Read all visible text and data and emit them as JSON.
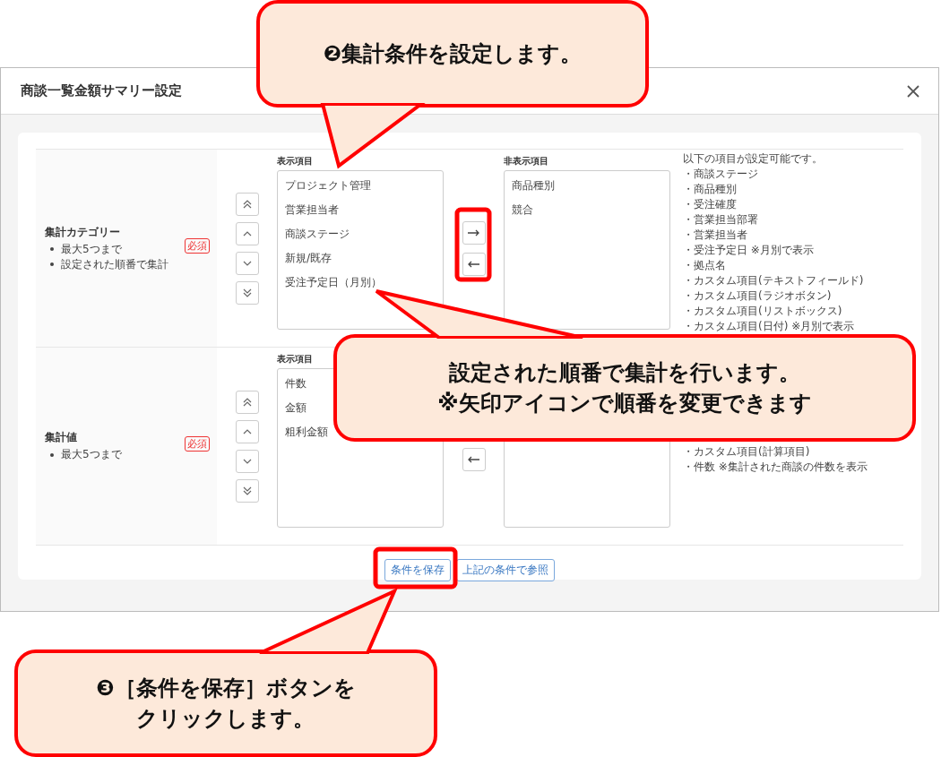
{
  "dialog": {
    "title": "商談一覧金額サマリー設定"
  },
  "sections": [
    {
      "label": "集計カテゴリー",
      "bullets": [
        "最大5つまで",
        "設定された順番で集計"
      ],
      "badge": "必須",
      "order_buttons": [
        {
          "kind": "top"
        },
        {
          "kind": "up"
        },
        {
          "kind": "down"
        },
        {
          "kind": "bottom"
        }
      ],
      "shown_header": "表示項目",
      "shown_items": [
        "プロジェクト管理",
        "営業担当者",
        "商談ステージ",
        "新規/既存",
        "受注予定日（月別）"
      ],
      "move_buttons": [
        {
          "kind": "right"
        },
        {
          "kind": "left"
        }
      ],
      "hidden_header": "非表示項目",
      "hidden_items": [
        "商品種別",
        "競合"
      ],
      "notes": [
        "以下の項目が設定可能です。",
        "・商談ステージ",
        "・商品種別",
        "・受注確度",
        "・営業担当部署",
        "・営業担当者",
        "・受注予定日 ※月別で表示",
        "・拠点名",
        "・カスタム項目(テキストフィールド)",
        "・カスタム項目(ラジオボタン)",
        "・カスタム項目(リストボックス)",
        "・カスタム項目(日付) ※月別で表示"
      ]
    },
    {
      "label": "集計値",
      "bullets": [
        "最大5つまで"
      ],
      "badge": "必須",
      "order_buttons": [
        {
          "kind": "top"
        },
        {
          "kind": "up"
        },
        {
          "kind": "down"
        },
        {
          "kind": "bottom"
        }
      ],
      "shown_header": "表示項目",
      "shown_items": [
        "件数",
        "金額",
        "粗利金額"
      ],
      "move_buttons": [
        {
          "kind": "left"
        }
      ],
      "notes": [
        "・カスタム項目(計算項目)",
        "・件数 ※集計された商談の件数を表示"
      ]
    }
  ],
  "footer_buttons": [
    "条件を保存",
    "上記の条件で参照"
  ],
  "callouts": [
    {
      "lines": [
        "❷集計条件を設定します。"
      ]
    },
    {
      "lines": [
        "設定された順番で集計を行います。",
        "※矢印アイコンで順番を変更できます"
      ]
    },
    {
      "lines": [
        "❸［条件を保存］ボタンを",
        "クリックします。"
      ]
    }
  ]
}
